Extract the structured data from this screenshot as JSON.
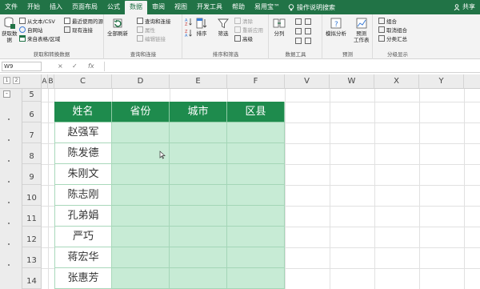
{
  "ribbon_tabs": [
    {
      "label": "文件"
    },
    {
      "label": "开始"
    },
    {
      "label": "插入"
    },
    {
      "label": "页面布局"
    },
    {
      "label": "公式"
    },
    {
      "label": "数据"
    },
    {
      "label": "审阅"
    },
    {
      "label": "视图"
    },
    {
      "label": "开发工具"
    },
    {
      "label": "帮助"
    },
    {
      "label": "易用宝™"
    }
  ],
  "active_tab": "数据",
  "tell_me": "操作说明搜索",
  "share": "共享",
  "groups": {
    "get_transform": {
      "label": "获取和转换数据",
      "get_data": "获取数\n据",
      "from_text": "从文本/CSV",
      "from_web": "自网站",
      "from_table": "来自表格/区域",
      "recent_sources": "最近使用的源",
      "existing_conn": "现有连接"
    },
    "queries": {
      "label": "查询和连接",
      "refresh_all": "全部刷新",
      "queries_conn": "查询和连接",
      "properties": "属性",
      "edit_links": "编辑链接"
    },
    "sort_filter": {
      "label": "排序和筛选",
      "sort": "排序",
      "filter": "筛选",
      "clear": "清除",
      "reapply": "重新应用",
      "advanced": "高级"
    },
    "data_tools": {
      "label": "数据工具",
      "text_to_columns": "分列"
    },
    "forecast": {
      "label": "预测",
      "what_if": "模拟分析",
      "forecast_sheet": "预测\n工作表"
    },
    "outline": {
      "label": "分级显示",
      "group": "组合",
      "ungroup": "取消组合",
      "subtotal": "分类汇总"
    }
  },
  "formula_bar": {
    "name_box": "W9",
    "cancel_icon": "×",
    "enter_icon": "✓",
    "fx": "fx",
    "formula": ""
  },
  "outline_levels": [
    "1",
    "2"
  ],
  "columns": [
    "A",
    "B",
    "C",
    "D",
    "E",
    "F",
    "V",
    "W",
    "X",
    "Y"
  ],
  "rows": [
    "5",
    "6",
    "7",
    "8",
    "9",
    "10",
    "11",
    "12",
    "13",
    "14"
  ],
  "table": {
    "headers": [
      "姓名",
      "省份",
      "城市",
      "区县"
    ],
    "names": [
      "赵强军",
      "陈发德",
      "朱刚文",
      "陈志刚",
      "孔弟娟",
      "严巧",
      "蒋宏华",
      "张惠芳"
    ]
  },
  "colors": {
    "ribbon_green": "#217346",
    "header_green": "#1e8b4d",
    "cell_green": "#c7ebd5"
  }
}
